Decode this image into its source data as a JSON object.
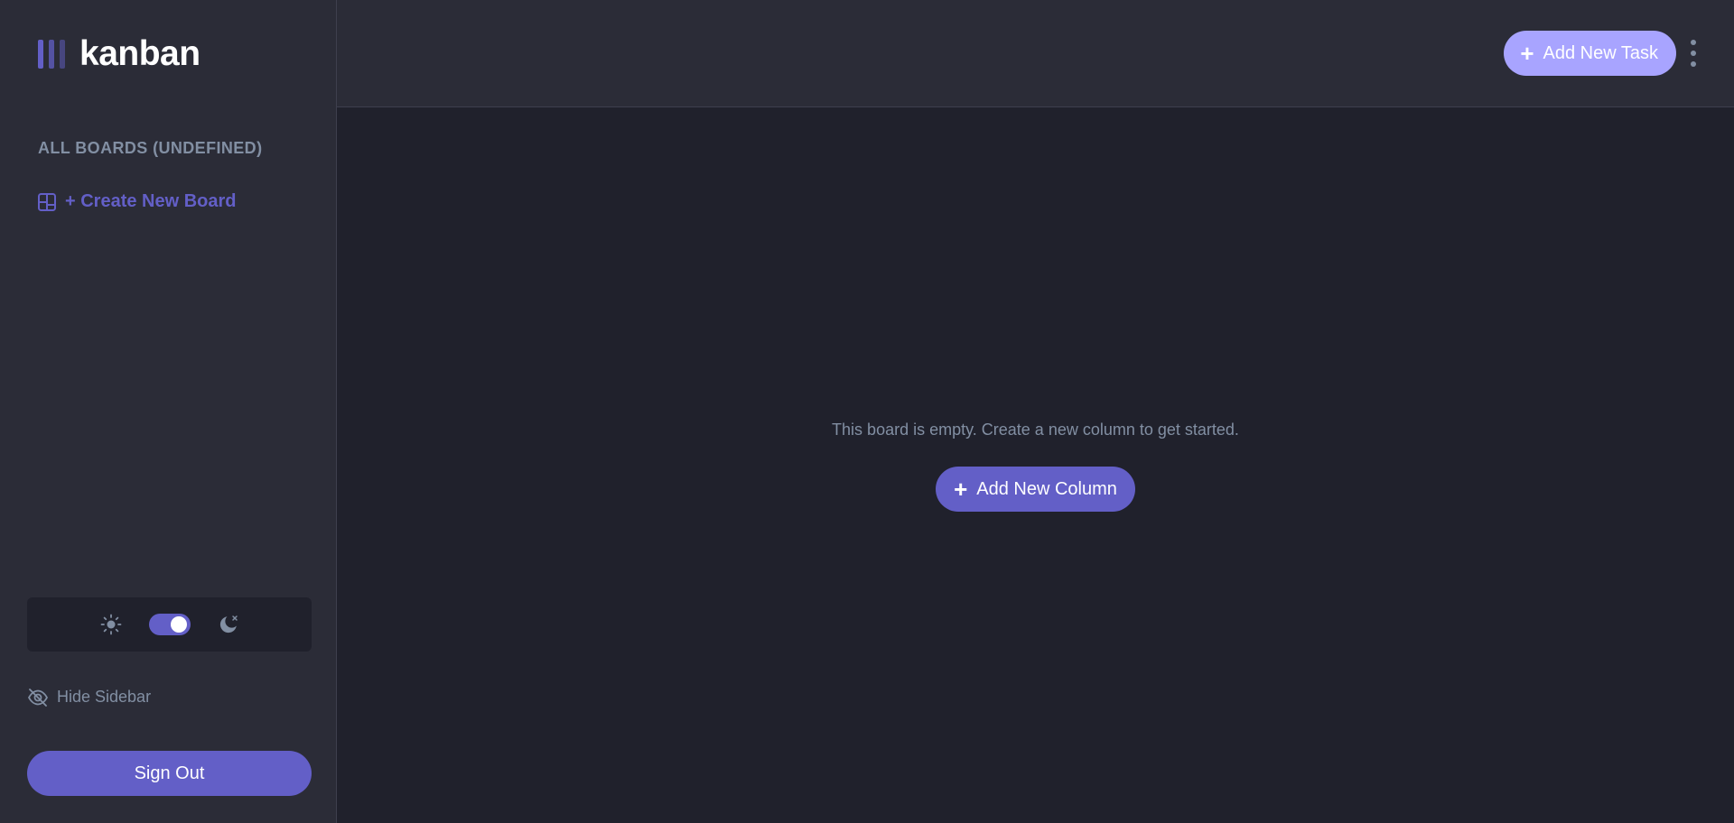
{
  "app": {
    "logo_text": "kanban"
  },
  "sidebar": {
    "boards_heading": "ALL BOARDS (UNDEFINED)",
    "create_board_label": "+ Create New Board",
    "hide_sidebar_label": "Hide Sidebar",
    "sign_out_label": "Sign Out",
    "theme": {
      "dark_mode_on": true
    }
  },
  "header": {
    "add_task_label": "Add New Task"
  },
  "board": {
    "empty_message": "This board is empty. Create a new column to get started.",
    "add_column_label": "Add New Column"
  },
  "colors": {
    "accent": "#635fc7",
    "accent_light": "#a8a4ff",
    "sidebar_bg": "#2b2c37",
    "main_bg": "#20212c",
    "muted_text": "#828fa3"
  },
  "icons": {
    "logo": "kanban-logo-icon",
    "board": "board-icon",
    "sun": "sun-icon",
    "moon": "moon-icon",
    "hide": "eye-slash-icon",
    "plus": "plus-icon",
    "menu": "vertical-ellipsis-icon"
  }
}
